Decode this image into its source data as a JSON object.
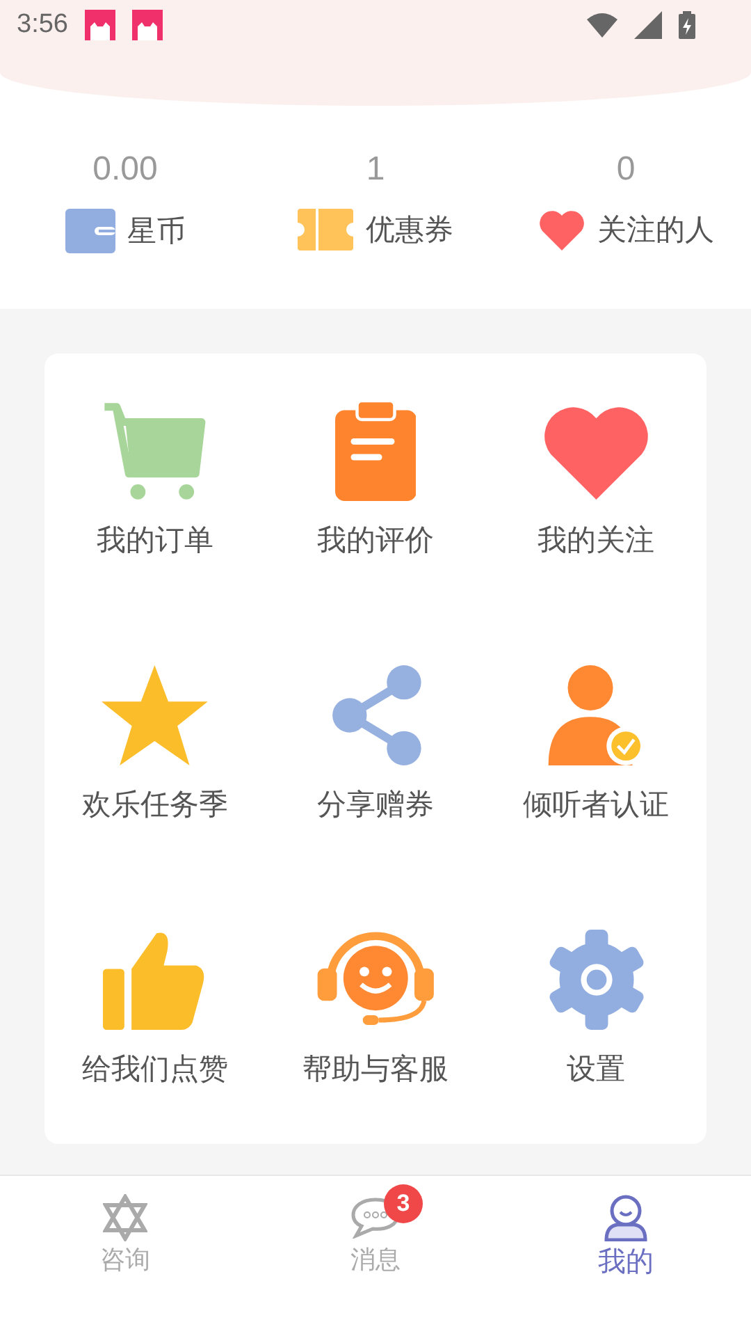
{
  "status_bar": {
    "time": "3:56",
    "notifications": [
      {
        "kind": "app"
      },
      {
        "kind": "app"
      }
    ]
  },
  "stats": [
    {
      "value": "0.00",
      "label": "星币",
      "kind": "wallet"
    },
    {
      "value": "1",
      "label": "优惠券",
      "kind": "ticket"
    },
    {
      "value": "0",
      "label": "关注的人",
      "kind": "heart"
    }
  ],
  "menu": [
    {
      "label": "我的订单",
      "kind": "cart"
    },
    {
      "label": "我的评价",
      "kind": "clipboard"
    },
    {
      "label": "我的关注",
      "kind": "heart"
    },
    {
      "label": "欢乐任务季",
      "kind": "star"
    },
    {
      "label": "分享赠券",
      "kind": "share"
    },
    {
      "label": "倾听者认证",
      "kind": "verified-user"
    },
    {
      "label": "给我们点赞",
      "kind": "thumb"
    },
    {
      "label": "帮助与客服",
      "kind": "headset"
    },
    {
      "label": "设置",
      "kind": "gear"
    }
  ],
  "tabs": [
    {
      "label": "咨询",
      "kind": "star",
      "selected": false
    },
    {
      "label": "消息",
      "kind": "chat",
      "selected": false,
      "badge": "3"
    },
    {
      "label": "我的",
      "kind": "person",
      "selected": true
    }
  ]
}
